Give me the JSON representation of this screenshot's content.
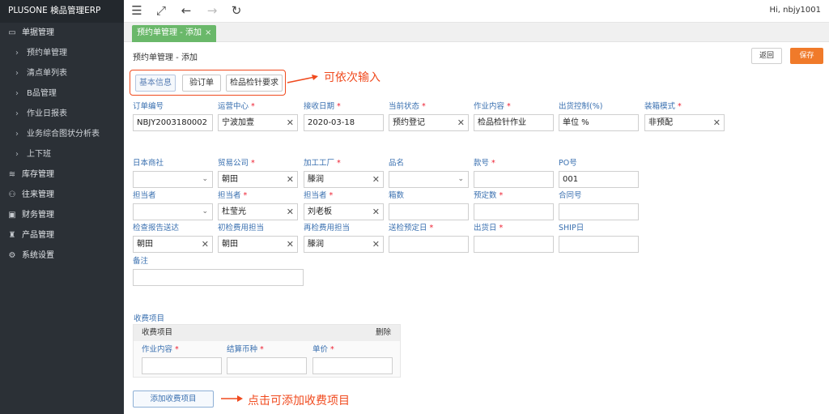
{
  "app": {
    "brand": "PLUSONE 検品管理ERP"
  },
  "sidebar": {
    "menus": [
      {
        "label": "单据管理",
        "icon": "monitor-icon"
      },
      {
        "label": "库存管理",
        "icon": "database-icon"
      },
      {
        "label": "往来管理",
        "icon": "user-icon"
      },
      {
        "label": "财务管理",
        "icon": "wallet-icon"
      },
      {
        "label": "产品管理",
        "icon": "product-icon"
      },
      {
        "label": "系统设置",
        "icon": "gear-icon"
      }
    ],
    "subitems": [
      "预约单管理",
      "清点单列表",
      "B品管理",
      "作业日报表",
      "业务综合图状分析表",
      "上下班"
    ]
  },
  "topbar": {
    "user": "Hi, nbjy1001"
  },
  "tabs": {
    "active": "预约单管理 - 添加"
  },
  "page": {
    "breadcrumb": "预约单管理 - 添加",
    "back_label": "返回",
    "save_label": "保存",
    "subtabs": [
      "基本信息",
      "验订单",
      "检品检针要求"
    ],
    "annotation_tabs": "可依次输入",
    "annotation_add": "点击可添加收费项目"
  },
  "form": {
    "row1": [
      {
        "label": "订单编号",
        "required": false,
        "value": "NBJY2003180002",
        "control": "text"
      },
      {
        "label": "运营中心",
        "required": true,
        "value": "宁波加壹",
        "control": "clear"
      },
      {
        "label": "接收日期",
        "required": true,
        "value": "2020-03-18",
        "control": "text"
      },
      {
        "label": "当前状态",
        "required": true,
        "value": "预约登记",
        "control": "clear"
      },
      {
        "label": "作业内容",
        "required": true,
        "value": "检品检针作业",
        "control": "text"
      },
      {
        "label": "出货控制(%)",
        "required": false,
        "value": "单位 %",
        "control": "text"
      },
      {
        "label": "装箱模式",
        "required": true,
        "value": "非预配",
        "control": "clear"
      }
    ],
    "row2": [
      {
        "label": "日本商社",
        "required": false,
        "value": "",
        "control": "select"
      },
      {
        "label": "贸易公司",
        "required": true,
        "value": "朝田",
        "control": "clear"
      },
      {
        "label": "加工工厂",
        "required": true,
        "value": "滕润",
        "control": "clear"
      },
      {
        "label": "品名",
        "required": false,
        "value": "",
        "control": "select"
      },
      {
        "label": "款号",
        "required": true,
        "value": "",
        "control": "text"
      },
      {
        "label": "PO号",
        "required": false,
        "value": "001",
        "control": "text"
      }
    ],
    "row3": [
      {
        "label": "担当者",
        "required": false,
        "value": "",
        "control": "select"
      },
      {
        "label": "担当者",
        "required": true,
        "value": "杜莹光",
        "control": "clear"
      },
      {
        "label": "担当者",
        "required": true,
        "value": "刘老板",
        "control": "clear"
      },
      {
        "label": "箱数",
        "required": false,
        "value": "",
        "control": "text"
      },
      {
        "label": "预定数",
        "required": true,
        "value": "",
        "control": "text"
      },
      {
        "label": "合同号",
        "required": false,
        "value": "",
        "control": "text"
      }
    ],
    "row4": [
      {
        "label": "检查报告送达",
        "required": false,
        "value": "朝田",
        "control": "clear"
      },
      {
        "label": "初检费用担当",
        "required": false,
        "value": "朝田",
        "control": "clear"
      },
      {
        "label": "再检费用担当",
        "required": false,
        "value": "滕润",
        "control": "clear"
      },
      {
        "label": "送检预定日",
        "required": true,
        "value": "",
        "control": "text"
      },
      {
        "label": "出货日",
        "required": true,
        "value": "",
        "control": "text"
      },
      {
        "label": "SHIP日",
        "required": false,
        "value": "",
        "control": "text"
      }
    ],
    "remark_label": "备注"
  },
  "fees": {
    "title": "收费项目",
    "header": "收费项目",
    "delete_label": "删除",
    "columns": [
      {
        "label": "作业内容",
        "required": true
      },
      {
        "label": "结算币种",
        "required": true
      },
      {
        "label": "单价",
        "required": true
      }
    ],
    "add_label": "添加收费项目"
  },
  "colors": {
    "sidebar": "#2b3036",
    "accent_green": "#6ab86a",
    "save_orange": "#f07a2a",
    "annotation_red": "#f04a1e",
    "label_blue": "#3a70b0"
  }
}
